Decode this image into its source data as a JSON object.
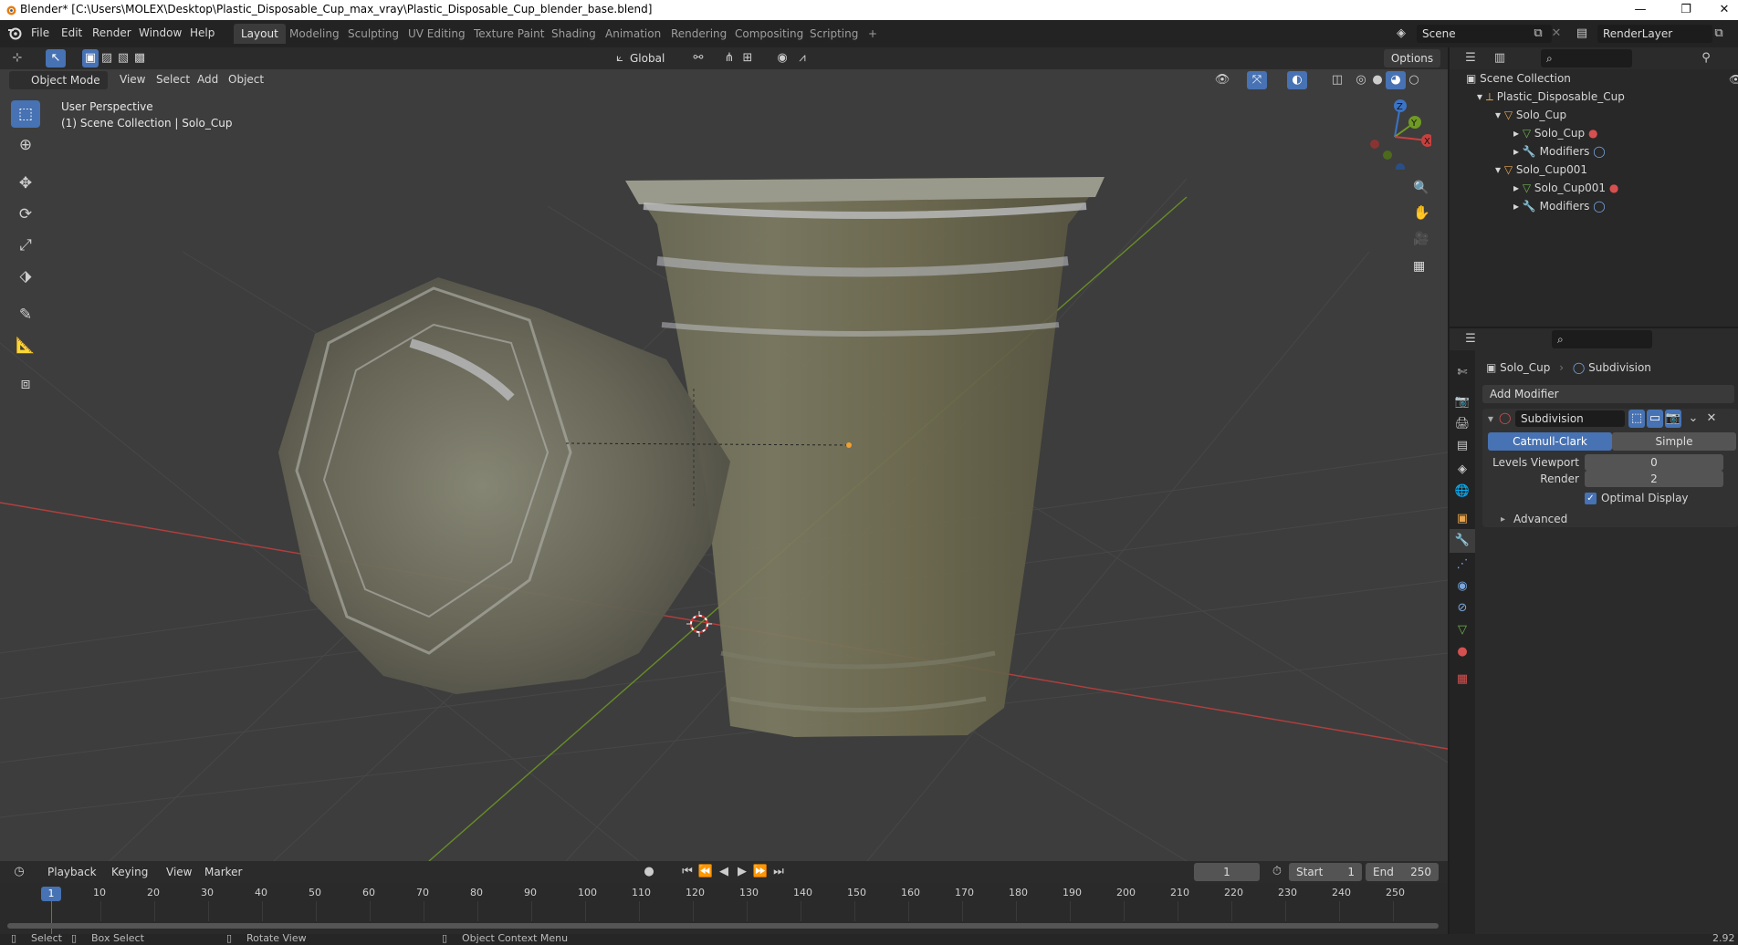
{
  "window": {
    "title": "Blender* [C:\\Users\\MOLEX\\Desktop\\Plastic_Disposable_Cup_max_vray\\Plastic_Disposable_Cup_blender_base.blend]",
    "minimize": "—",
    "maximize": "❐",
    "close": "✕"
  },
  "menu": [
    "File",
    "Edit",
    "Render",
    "Window",
    "Help"
  ],
  "workspaces": [
    {
      "label": "Layout",
      "active": true
    },
    {
      "label": "Modeling"
    },
    {
      "label": "Sculpting"
    },
    {
      "label": "UV Editing"
    },
    {
      "label": "Texture Paint"
    },
    {
      "label": "Shading"
    },
    {
      "label": "Animation"
    },
    {
      "label": "Rendering"
    },
    {
      "label": "Compositing"
    },
    {
      "label": "Scripting"
    }
  ],
  "add_workspace": "+",
  "scene": {
    "label": "Scene",
    "render_layer": "RenderLayer"
  },
  "viewport_header": {
    "transform_orientation": "Global",
    "options": "Options",
    "mode": "Object Mode",
    "menus": [
      "View",
      "Select",
      "Add",
      "Object"
    ]
  },
  "viewport": {
    "perspective": "User Perspective",
    "collection": "(1) Scene Collection | Solo_Cup",
    "gizmo": {
      "z": "Z",
      "y": "Y",
      "x": "X"
    }
  },
  "outliner": {
    "root": "Scene Collection",
    "rows": [
      {
        "label": "Plastic_Disposable_Cup"
      },
      {
        "label": "Solo_Cup"
      },
      {
        "label": "Solo_Cup"
      },
      {
        "label": "Modifiers"
      },
      {
        "label": "Solo_Cup001"
      },
      {
        "label": "Solo_Cup001"
      },
      {
        "label": "Modifiers"
      }
    ]
  },
  "properties": {
    "object": "Solo_Cup",
    "modifier_context": "Subdivision",
    "add_modifier": "Add Modifier",
    "modifier": {
      "name": "Subdivision",
      "types": [
        "Catmull-Clark",
        "Simple"
      ],
      "active_type": "Catmull-Clark",
      "levels_viewport_label": "Levels Viewport",
      "levels_viewport": "0",
      "render_label": "Render",
      "render": "2",
      "optimal_display": "Optimal Display",
      "optimal_display_checked": true,
      "advanced": "Advanced"
    }
  },
  "timeline": {
    "menus": [
      "Playback",
      "Keying",
      "View",
      "Marker"
    ],
    "current_frame": "1",
    "start_label": "Start",
    "start": "1",
    "end_label": "End",
    "end": "250",
    "ticks": [
      "10",
      "20",
      "30",
      "40",
      "50",
      "60",
      "70",
      "80",
      "90",
      "100",
      "110",
      "120",
      "130",
      "140",
      "150",
      "160",
      "170",
      "180",
      "190",
      "200",
      "210",
      "220",
      "230",
      "240",
      "250"
    ],
    "playhead": "1"
  },
  "statusbar": {
    "select": "Select",
    "box_select": "Box Select",
    "rotate": "Rotate View",
    "context": "Object Context Menu",
    "version": "2.92"
  },
  "colors": {
    "accent": "#4772b3",
    "x_axis": "#c8403e",
    "y_axis": "#6f9a24",
    "z_axis": "#3b74c5"
  }
}
